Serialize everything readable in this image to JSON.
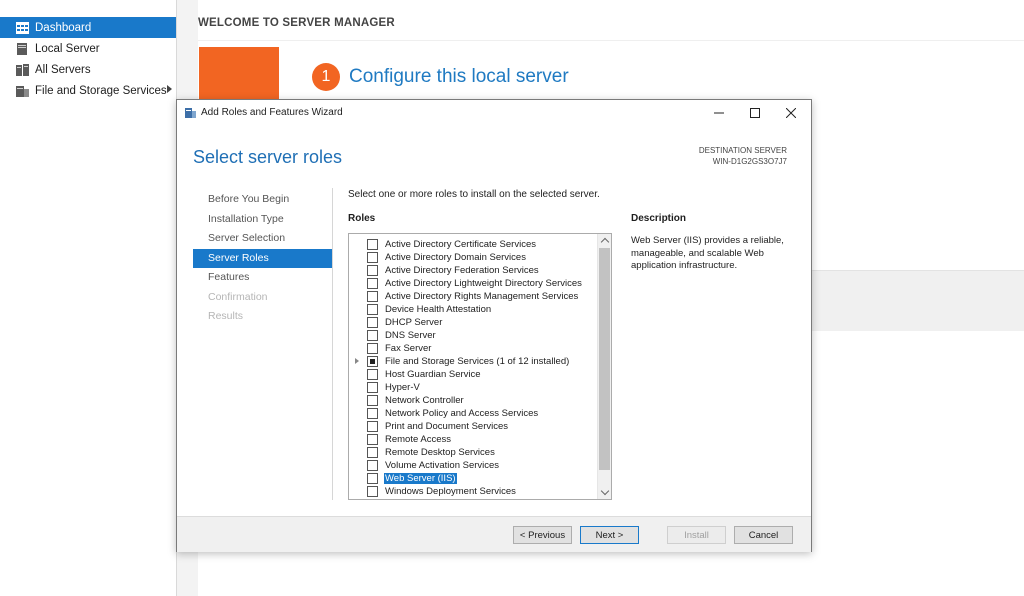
{
  "sidebar": {
    "items": [
      {
        "label": "Dashboard",
        "icon": "dashboard-icon",
        "selected": true
      },
      {
        "label": "Local Server",
        "icon": "server-icon",
        "selected": false
      },
      {
        "label": "All Servers",
        "icon": "servers-icon",
        "selected": false
      },
      {
        "label": "File and Storage Services",
        "icon": "storage-icon",
        "selected": false,
        "has_submenu": true
      }
    ]
  },
  "main": {
    "welcome_title": "WELCOME TO SERVER MANAGER",
    "step_number": "1",
    "step_text": "Configure this local server"
  },
  "wizard": {
    "window_title": "Add Roles and Features Wizard",
    "page_heading": "Select server roles",
    "destination_label": "DESTINATION SERVER",
    "destination_value": "WIN-D1G2GS3O7J7",
    "steps": [
      {
        "label": "Before You Begin",
        "state": "normal"
      },
      {
        "label": "Installation Type",
        "state": "normal"
      },
      {
        "label": "Server Selection",
        "state": "normal"
      },
      {
        "label": "Server Roles",
        "state": "current"
      },
      {
        "label": "Features",
        "state": "normal"
      },
      {
        "label": "Confirmation",
        "state": "disabled"
      },
      {
        "label": "Results",
        "state": "disabled"
      }
    ],
    "instruction": "Select one or more roles to install on the selected server.",
    "roles_heading": "Roles",
    "description_heading": "Description",
    "description_text": "Web Server (IIS) provides a reliable, manageable, and scalable Web application infrastructure.",
    "roles": [
      {
        "label": "Active Directory Certificate Services",
        "state": "unchecked"
      },
      {
        "label": "Active Directory Domain Services",
        "state": "unchecked"
      },
      {
        "label": "Active Directory Federation Services",
        "state": "unchecked"
      },
      {
        "label": "Active Directory Lightweight Directory Services",
        "state": "unchecked"
      },
      {
        "label": "Active Directory Rights Management Services",
        "state": "unchecked"
      },
      {
        "label": "Device Health Attestation",
        "state": "unchecked"
      },
      {
        "label": "DHCP Server",
        "state": "unchecked"
      },
      {
        "label": "DNS Server",
        "state": "unchecked"
      },
      {
        "label": "Fax Server",
        "state": "unchecked"
      },
      {
        "label": "File and Storage Services (1 of 12 installed)",
        "state": "partial",
        "expandable": true
      },
      {
        "label": "Host Guardian Service",
        "state": "unchecked"
      },
      {
        "label": "Hyper-V",
        "state": "unchecked"
      },
      {
        "label": "Network Controller",
        "state": "unchecked"
      },
      {
        "label": "Network Policy and Access Services",
        "state": "unchecked"
      },
      {
        "label": "Print and Document Services",
        "state": "unchecked"
      },
      {
        "label": "Remote Access",
        "state": "unchecked"
      },
      {
        "label": "Remote Desktop Services",
        "state": "unchecked"
      },
      {
        "label": "Volume Activation Services",
        "state": "unchecked"
      },
      {
        "label": "Web Server (IIS)",
        "state": "unchecked",
        "selected": true
      },
      {
        "label": "Windows Deployment Services",
        "state": "unchecked"
      }
    ],
    "buttons": {
      "previous": "< Previous",
      "next": "Next >",
      "install": "Install",
      "cancel": "Cancel"
    }
  },
  "colors": {
    "accent": "#1979ca",
    "heading_blue": "#1f6fb5",
    "orange": "#f26522"
  }
}
